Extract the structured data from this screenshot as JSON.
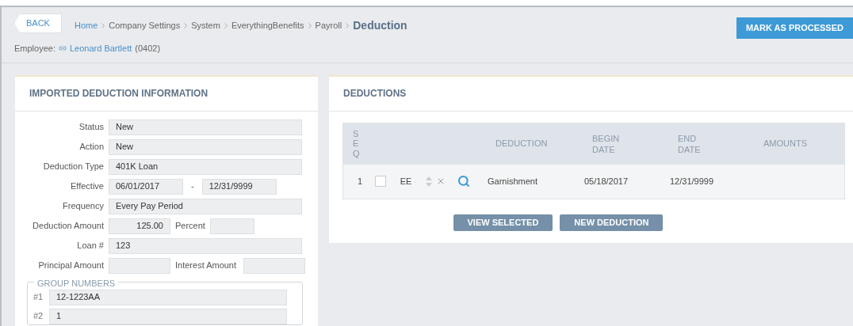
{
  "header": {
    "back": "BACK",
    "breadcrumb": [
      {
        "label": "Home",
        "kind": "link"
      },
      {
        "label": "Company Settings",
        "kind": "plain"
      },
      {
        "label": "System",
        "kind": "plain"
      },
      {
        "label": "EverythingBenefits",
        "kind": "plain"
      },
      {
        "label": "Payroll",
        "kind": "plain"
      },
      {
        "label": "Deduction",
        "kind": "current"
      }
    ],
    "employee_label": "Employee:",
    "employee_name": "Leonard Bartlett",
    "employee_id": "(0402)",
    "action": "MARK AS PROCESSED"
  },
  "info_panel": {
    "title": "IMPORTED DEDUCTION INFORMATION",
    "fields": [
      {
        "kind": "single",
        "label": "Status",
        "value": "New"
      },
      {
        "kind": "single",
        "label": "Action",
        "value": "New"
      },
      {
        "kind": "single",
        "label": "Deduction Type",
        "value": "401K Loan"
      },
      {
        "kind": "range",
        "label": "Effective",
        "value": "06/01/2017",
        "separator": "-",
        "value2": "12/31/9999"
      },
      {
        "kind": "single",
        "label": "Frequency",
        "value": "Every Pay Period"
      },
      {
        "kind": "pair",
        "label": "Deduction Amount",
        "value": "125.00",
        "label2": "Percent"
      },
      {
        "kind": "single",
        "label": "Loan #",
        "value": "123"
      },
      {
        "kind": "pair",
        "label": "Principal Amount",
        "label2": "Interest Amount"
      }
    ],
    "group_numbers": {
      "title": "GROUP NUMBERS",
      "items": [
        {
          "label": "#1",
          "value": "12-1223AA"
        },
        {
          "label": "#2",
          "value": "1"
        }
      ]
    }
  },
  "deductions_panel": {
    "title": "DEDUCTIONS",
    "columns": [
      "SEQ",
      "DEDUCTION",
      "BEGIN DATE",
      "END DATE",
      "AMOUNTS"
    ],
    "rows": [
      {
        "seq": "1",
        "checked": false,
        "type": "EE",
        "deduction": "Garnishment",
        "begin": "05/18/2017",
        "end": "12/31/9999"
      }
    ],
    "buttons": [
      "VIEW SELECTED",
      "NEW DEDUCTION"
    ]
  }
}
